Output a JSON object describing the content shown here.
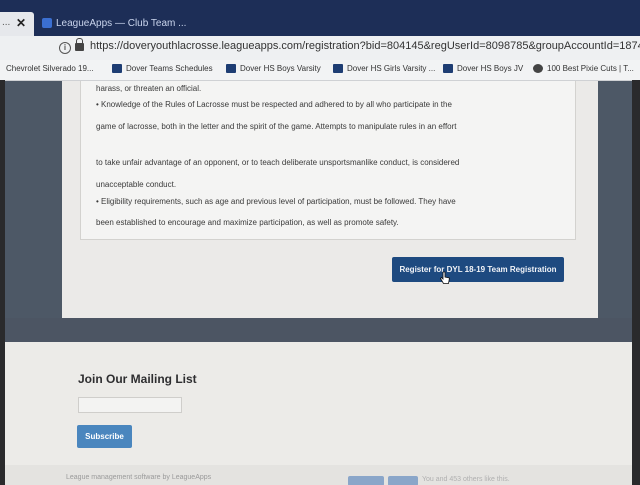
{
  "browser": {
    "prev_tab_title": "...",
    "active_tab_title": "LeagueApps — Club Team ...",
    "url": "https://doveryouthlacrosse.leagueapps.com/registration?bid=804145&regUserId=8098785&groupAccountId=1874034&type=te"
  },
  "bookmarks": [
    {
      "label": "Chevrolet Silverado 19...",
      "icon": "bookmark-icon"
    },
    {
      "label": "Dover Teams Schedules",
      "icon": "bookmark-icon"
    },
    {
      "label": "Dover HS Boys Varsity",
      "icon": "bookmark-icon"
    },
    {
      "label": "Dover HS Girls Varsity ...",
      "icon": "bookmark-icon"
    },
    {
      "label": "Dover HS Boys JV",
      "icon": "bookmark-icon"
    },
    {
      "label": "100 Best Pixie Cuts | T...",
      "icon": "globe-icon"
    }
  ],
  "content": {
    "lines": [
      "harass, or threaten an official.",
      "• Knowledge of the Rules of Lacrosse must be respected and adhered to by all who participate in the",
      "game of lacrosse, both in the letter and the spirit of the game. Attempts to manipulate rules in an effort",
      "to take unfair advantage of an opponent, or to teach deliberate unsportsmanlike conduct, is considered",
      "unacceptable conduct.",
      "• Eligibility requirements, such as age and previous level of participation, must be followed. They have",
      "been established to encourage and maximize participation, as well as promote safety."
    ],
    "register_button": "Register for DYL 18-19 Team Registration"
  },
  "mailing": {
    "title": "Join Our Mailing List",
    "email_value": "",
    "subscribe_label": "Subscribe"
  },
  "footer": {
    "text": "League management software by LeagueApps",
    "social_text": "You and 453 others like this."
  },
  "colors": {
    "tab_bar": "#1d2e57",
    "register_button": "#1e4a80",
    "subscribe_button": "#4a86be",
    "dark_band": "#4c5563"
  }
}
